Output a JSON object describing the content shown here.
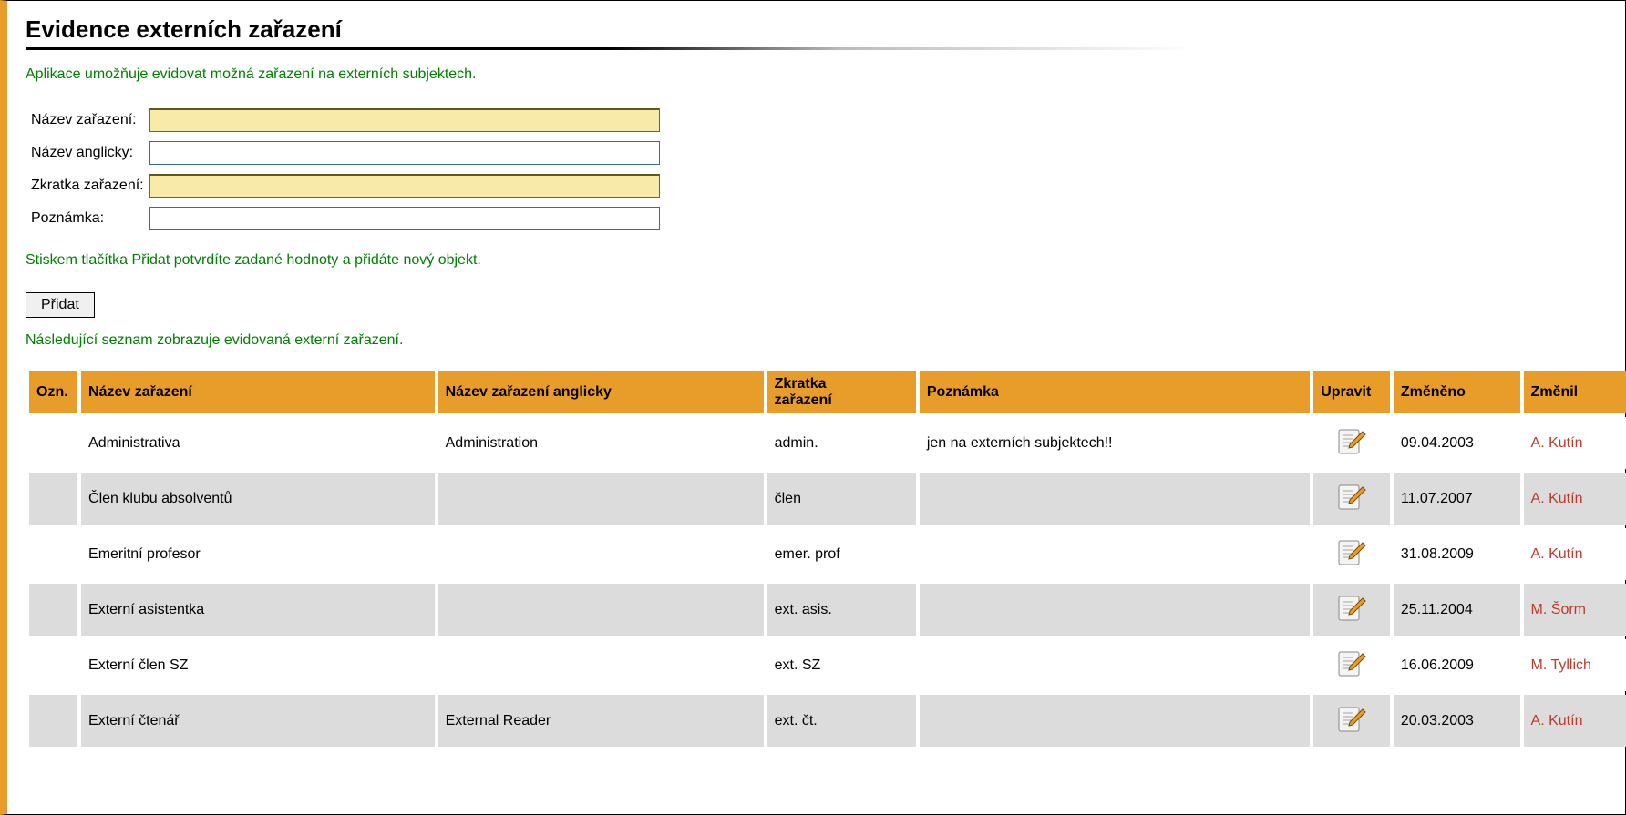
{
  "page": {
    "title": "Evidence externích zařazení",
    "intro": "Aplikace umožňuje evidovat možná zařazení na externích subjektech.",
    "confirm_hint": "Stiskem tlačítka Přidat potvrdíte zadané hodnoty a přidáte nový objekt.",
    "list_hint": "Následující seznam zobrazuje evidovaná externí zařazení."
  },
  "form": {
    "labels": {
      "nazev": "Název zařazení:",
      "anglicky": "Název anglicky:",
      "zkratka": "Zkratka zařazení:",
      "poznamka": "Poznámka:"
    },
    "values": {
      "nazev": "",
      "anglicky": "",
      "zkratka": "",
      "poznamka": ""
    },
    "add_button": "Přidat"
  },
  "table": {
    "headers": {
      "ozn": "Ozn.",
      "nazev": "Název zařazení",
      "anglicky": "Název zařazení anglicky",
      "zkratka_line1": "Zkratka",
      "zkratka_line2": "zařazení",
      "poznamka": "Poznámka",
      "upravit": "Upravit",
      "zmeneno": "Změněno",
      "zmenil": "Změnil"
    },
    "rows": [
      {
        "ozn": "",
        "nazev": "Administrativa",
        "anglicky": "Administration",
        "zkratka": "admin.",
        "poznamka": "jen na externích subjektech!!",
        "zmeneno": "09.04.2003",
        "zmenil": "A. Kutín"
      },
      {
        "ozn": "",
        "nazev": "Člen klubu absolventů",
        "anglicky": "",
        "zkratka": "člen",
        "poznamka": "",
        "zmeneno": "11.07.2007",
        "zmenil": "A. Kutín"
      },
      {
        "ozn": "",
        "nazev": "Emeritní profesor",
        "anglicky": "",
        "zkratka": "emer. prof",
        "poznamka": "",
        "zmeneno": "31.08.2009",
        "zmenil": "A. Kutín"
      },
      {
        "ozn": "",
        "nazev": "Externí asistentka",
        "anglicky": "",
        "zkratka": "ext. asis.",
        "poznamka": "",
        "zmeneno": "25.11.2004",
        "zmenil": "M. Šorm"
      },
      {
        "ozn": "",
        "nazev": "Externí člen SZ",
        "anglicky": "",
        "zkratka": "ext. SZ",
        "poznamka": "",
        "zmeneno": "16.06.2009",
        "zmenil": "M. Tyllich"
      },
      {
        "ozn": "",
        "nazev": "Externí čtenář",
        "anglicky": "External Reader",
        "zkratka": "ext. čt.",
        "poznamka": "",
        "zmeneno": "20.03.2003",
        "zmenil": "A. Kutín"
      }
    ]
  }
}
